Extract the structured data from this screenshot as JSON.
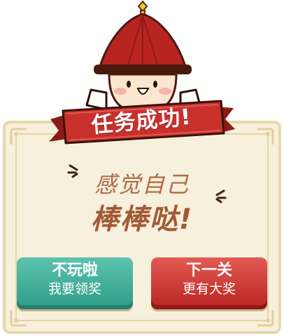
{
  "ribbon": {
    "title": "任务成功!"
  },
  "message": {
    "line1": "感觉自己",
    "line2": "棒棒哒!"
  },
  "buttons": {
    "quit": {
      "line1": "不玩啦",
      "line2": "我要领奖"
    },
    "next": {
      "line1": "下一关",
      "line2": "更有大奖"
    }
  },
  "colors": {
    "ribbon_red": "#c8302c",
    "quit_green": "#3aa894",
    "next_red": "#c8302c",
    "card_bg": "#f6f0dc",
    "text_brown": "#a15a35"
  }
}
